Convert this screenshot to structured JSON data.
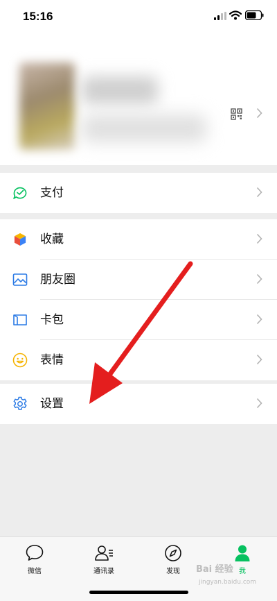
{
  "status_bar": {
    "time": "15:16"
  },
  "menu": {
    "pay": {
      "label": "支付",
      "icon": "pay-icon",
      "color": "#07c160"
    },
    "group2": [
      {
        "label": "收藏",
        "icon": "favorites-cube-icon"
      },
      {
        "label": "朋友圈",
        "icon": "moments-image-icon"
      },
      {
        "label": "卡包",
        "icon": "card-wallet-icon"
      },
      {
        "label": "表情",
        "icon": "sticker-smiley-icon"
      }
    ],
    "settings": {
      "label": "设置",
      "icon": "gear-icon",
      "color": "#2c7be5"
    }
  },
  "tabbar": {
    "tabs": [
      {
        "label": "微信",
        "icon": "chat-bubble-icon",
        "active": false
      },
      {
        "label": "通讯录",
        "icon": "contacts-icon",
        "active": false
      },
      {
        "label": "发现",
        "icon": "compass-icon",
        "active": false
      },
      {
        "label": "我",
        "icon": "me-person-icon",
        "active": true
      }
    ],
    "active_color": "#07c160"
  },
  "watermark": {
    "text": "Bai 经验",
    "sub": "jingyan.baidu.com"
  },
  "annotation": {
    "arrow_color": "#e41e1e"
  }
}
